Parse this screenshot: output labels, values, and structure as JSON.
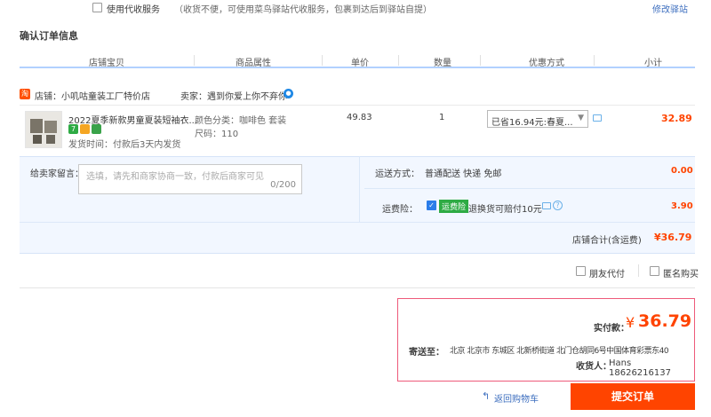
{
  "top": {
    "cod_label": "使用代收服务",
    "cod_desc": "（收货不便，可使用菜鸟驿站代收服务，包裹到达后到驿站自提）",
    "modify_link": "修改驿站"
  },
  "section_title": "确认订单信息",
  "columns": [
    "店铺宝贝",
    "商品属性",
    "单价",
    "数量",
    "优惠方式",
    "小计"
  ],
  "shop": {
    "icon_char": "淘",
    "name": "店铺：小叽咕童装工厂特价店",
    "seller": "卖家：遇到你爱上你不弃你"
  },
  "item": {
    "title": "2022夏季新款男童夏装短袖衣...",
    "badge_text": "7",
    "ship_time": "发货时间：付款后3天内发货",
    "attr_color": "颜色分类：咖啡色 套装",
    "attr_size": "尺码：110",
    "price": "49.83",
    "qty": "1",
    "discount": "已省16.94元:春夏...",
    "subtotal": "32.89"
  },
  "message": {
    "label": "给卖家留言：",
    "placeholder": "选填，请先和商家协商一致，付款后商家可见",
    "count": "0/200"
  },
  "shipping": {
    "label": "运送方式：",
    "value": "普通配送 快递 免邮",
    "price": "0.00"
  },
  "insurance": {
    "label": "运费险：",
    "tag": "运费险",
    "desc": "退换货可赔付10元",
    "price": "3.90"
  },
  "shop_total": {
    "label": "店铺合计(含运费)",
    "value": "¥36.79"
  },
  "options": {
    "friend_pay": "朋友代付",
    "anonymous": "匿名购买"
  },
  "summary": {
    "pay_label": "实付款：",
    "currency": "¥",
    "amount": "36.79",
    "ship_to_label": "寄送至：",
    "address": "北京 北京市 东城区 北新桥街道 北门仓胡同6号中国体育彩票东40",
    "receiver_label": "收货人：",
    "receiver": "Hans 18626216137"
  },
  "footer": {
    "back_link": "返回购物车",
    "submit": "提交订单"
  },
  "colors": {
    "accent": "#ff4400",
    "link": "#3e6fbf",
    "header_line": "#b2d1ff",
    "panel_bg": "#f2f7ff",
    "summary_border": "#ee5a7a",
    "green": "#2eab44",
    "blue": "#1e88e5"
  }
}
